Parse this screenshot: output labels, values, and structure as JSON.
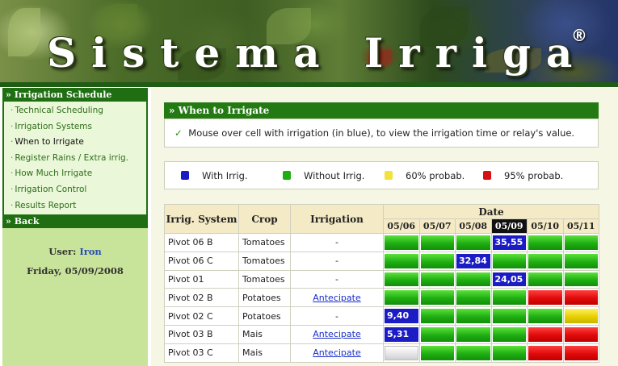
{
  "banner": {
    "title": "Sistema Irriga",
    "reg": "®"
  },
  "sidebar": {
    "header": "» Irrigation Schedule",
    "items": [
      {
        "label": "Technical Scheduling",
        "current": false
      },
      {
        "label": "Irrigation Systems",
        "current": false
      },
      {
        "label": "When to Irrigate",
        "current": true
      },
      {
        "label": "Register Rains / Extra irrig.",
        "current": false
      },
      {
        "label": "How Much Irrigate",
        "current": false
      },
      {
        "label": "Irrigation Control",
        "current": false
      },
      {
        "label": "Results Report",
        "current": false
      }
    ],
    "back": "» Back",
    "user_label": "User:",
    "user_name": "Iron",
    "date": "Friday, 05/09/2008"
  },
  "main": {
    "section_title": "» When to Irrigate",
    "check_icon": "✓",
    "hint": "Mouse over cell with irrigation (in blue), to view the irrigation time or relay's value."
  },
  "legend": [
    {
      "label": "With Irrig.",
      "color": "#1c1cc4"
    },
    {
      "label": "Without Irrig.",
      "color": "#1fae12"
    },
    {
      "label": "60% probab.",
      "color": "#f3e23a"
    },
    {
      "label": "95% probab.",
      "color": "#d91010"
    }
  ],
  "table": {
    "headers": {
      "system": "Irrig. System",
      "crop": "Crop",
      "irrigation": "Irrigation",
      "date": "Date"
    },
    "days": [
      "05/06",
      "05/07",
      "05/08",
      "05/09",
      "05/10",
      "05/11"
    ],
    "selected_day": "05/09",
    "rows": [
      {
        "system": "Pivot 06 B",
        "crop": "Tomatoes",
        "irrigation": "-",
        "link": false,
        "cells": [
          {
            "c": "g"
          },
          {
            "c": "g"
          },
          {
            "c": "g"
          },
          {
            "c": "b",
            "v": "35,55"
          },
          {
            "c": "g"
          },
          {
            "c": "g"
          }
        ]
      },
      {
        "system": "Pivot 06 C",
        "crop": "Tomatoes",
        "irrigation": "-",
        "link": false,
        "cells": [
          {
            "c": "g"
          },
          {
            "c": "g"
          },
          {
            "c": "b",
            "v": "32,84"
          },
          {
            "c": "g"
          },
          {
            "c": "g"
          },
          {
            "c": "g"
          }
        ]
      },
      {
        "system": "Pivot 01",
        "crop": "Tomatoes",
        "irrigation": "-",
        "link": false,
        "cells": [
          {
            "c": "g"
          },
          {
            "c": "g"
          },
          {
            "c": "g"
          },
          {
            "c": "b",
            "v": "24,05"
          },
          {
            "c": "g"
          },
          {
            "c": "g"
          }
        ]
      },
      {
        "system": "Pivot 02 B",
        "crop": "Potatoes",
        "irrigation": "Antecipate",
        "link": true,
        "cells": [
          {
            "c": "g"
          },
          {
            "c": "g"
          },
          {
            "c": "g"
          },
          {
            "c": "g"
          },
          {
            "c": "r"
          },
          {
            "c": "r"
          }
        ]
      },
      {
        "system": "Pivot 02 C",
        "crop": "Potatoes",
        "irrigation": "-",
        "link": false,
        "cells": [
          {
            "c": "b",
            "v": "9,40"
          },
          {
            "c": "g"
          },
          {
            "c": "g"
          },
          {
            "c": "g"
          },
          {
            "c": "g"
          },
          {
            "c": "y"
          }
        ]
      },
      {
        "system": "Pivot 03 B",
        "crop": "Mais",
        "irrigation": "Antecipate",
        "link": true,
        "cells": [
          {
            "c": "b",
            "v": "5,31"
          },
          {
            "c": "g"
          },
          {
            "c": "g"
          },
          {
            "c": "g"
          },
          {
            "c": "r"
          },
          {
            "c": "r"
          }
        ]
      },
      {
        "system": "Pivot 03 C",
        "crop": "Mais",
        "irrigation": "Antecipate",
        "link": true,
        "cells": [
          {
            "c": "w"
          },
          {
            "c": "g"
          },
          {
            "c": "g"
          },
          {
            "c": "g"
          },
          {
            "c": "r"
          },
          {
            "c": "r"
          }
        ]
      }
    ]
  }
}
